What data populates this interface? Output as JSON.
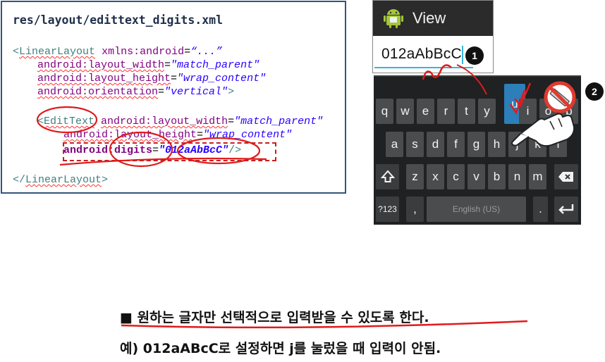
{
  "code": {
    "title": "res/layout/edittext_digits.xml",
    "l1_open": "<",
    "l1_tag": "LinearLayout",
    "l1_attr": "xmlns:android",
    "l1_eq": "=",
    "l1_val": "“...”",
    "l2_attr": "android:layout_width",
    "l2_eq": "=",
    "l2_val": "\"match_parent\"",
    "l3_attr": "android:layout_height",
    "l3_eq": "=",
    "l3_val": "\"wrap_content\"",
    "l4_attr": "android:orientation",
    "l4_eq": "=",
    "l4_val": "\"vertical\"",
    "l4_close": ">",
    "l5_open": "<",
    "l5_tag": "EditText",
    "l5_attr": "android:layout_width",
    "l5_eq": "=",
    "l5_val": "\"match_parent\"",
    "l6_attr": "android:layout_height",
    "l6_eq": "=",
    "l6_val": "\"wrap_content\"",
    "l7_attr": "android:digits",
    "l7_eq": "=",
    "l7_val": "\"012aAbBcC\"",
    "l7_close": "/>",
    "l8_open": "</",
    "l8_tag": "LinearLayout",
    "l8_close": ">"
  },
  "phone": {
    "app_title": "View",
    "input_value": "012aAbBcC",
    "badge_1": "1",
    "badge_2": "2",
    "icon": "android-robot-icon"
  },
  "keyboard": {
    "row1": [
      "q",
      "w",
      "e",
      "r",
      "t",
      "y",
      "u",
      "i",
      "o",
      "p"
    ],
    "row2": [
      "a",
      "s",
      "d",
      "f",
      "g",
      "h",
      "j",
      "k",
      "l"
    ],
    "row3": [
      "z",
      "x",
      "c",
      "v",
      "b",
      "n",
      "m"
    ],
    "shift_icon": "shift-arrow-icon",
    "backspace_icon": "backspace-icon",
    "symbols_key": "?123",
    "comma_key": ",",
    "space_label": "English (US)",
    "period_key": ".",
    "enter_icon": "enter-icon"
  },
  "notes": {
    "line1": "■ 원하는 글자만 선택적으로 입력받을 수 있도록 한다.",
    "line2": "예) 012aABcC로 설정하면 j를 눌렀을 때 입력이 안됨."
  },
  "colors": {
    "tag": "#3f7f7f",
    "attr": "#7f007f",
    "value": "#2a00ff",
    "annotation_red": "#e01b1b",
    "accent_blue": "#33b5e5"
  }
}
